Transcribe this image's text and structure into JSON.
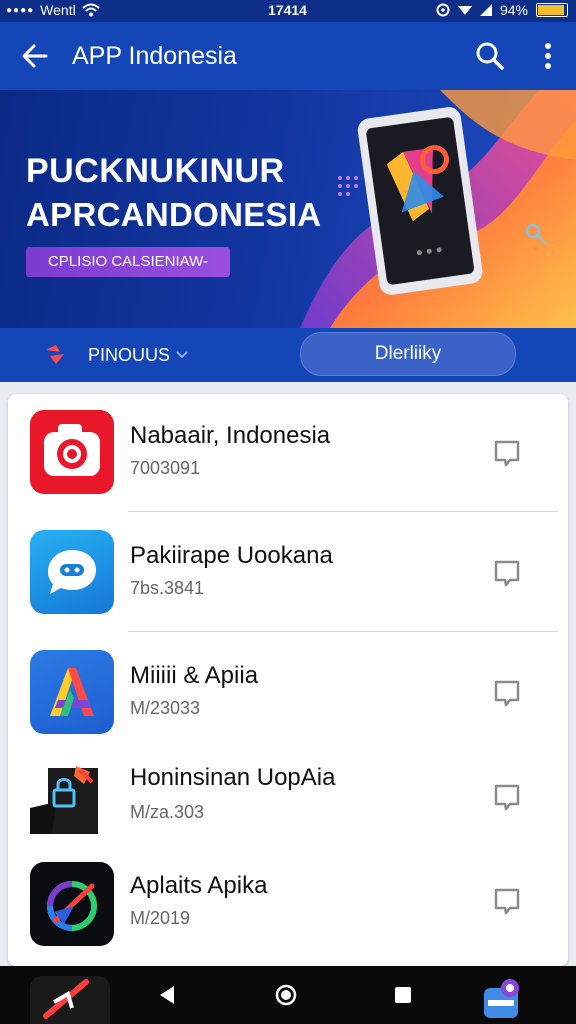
{
  "status_bar": {
    "carrier": "Wentl",
    "time": "17414",
    "battery": "94%",
    "battery_level": 0.94
  },
  "app_bar": {
    "title": "APP Indonesia",
    "back_icon": "arrow-left-icon",
    "search_icon": "search-icon",
    "more_icon": "more-vert-icon"
  },
  "banner": {
    "line1": "PUCKNUKINUR",
    "line2": "APRCANDONESIA",
    "pill_label": "CPLISIO CALSIENIAW-"
  },
  "filter": {
    "dropdown_label": "PINOUUS",
    "pill_label": "Dlerliiky"
  },
  "apps": [
    {
      "name": "Nabaair, Indonesia",
      "subtitle": "7003091",
      "icon": "red-camera-icon"
    },
    {
      "name": "Pakiirape Uookana",
      "subtitle": "7bs.3841",
      "icon": "blue-chat-icon"
    },
    {
      "name": "Miiiii & Apiia",
      "subtitle": "M/23033",
      "icon": "colorful-a-icon"
    },
    {
      "name": "Honinsinan UopAia",
      "subtitle": "M/za.303",
      "icon": "lock-badge-icon"
    },
    {
      "name": "Aplaits Apika",
      "subtitle": "M/2019",
      "icon": "compass-ring-icon"
    }
  ],
  "nav": {
    "back": "nav-back-icon",
    "home": "nav-home-icon",
    "recents": "nav-recents-icon"
  },
  "colors": {
    "app_bar": "#1446b8",
    "status_bar": "#0d2f8a",
    "accent_purple": "#8a46d8"
  }
}
